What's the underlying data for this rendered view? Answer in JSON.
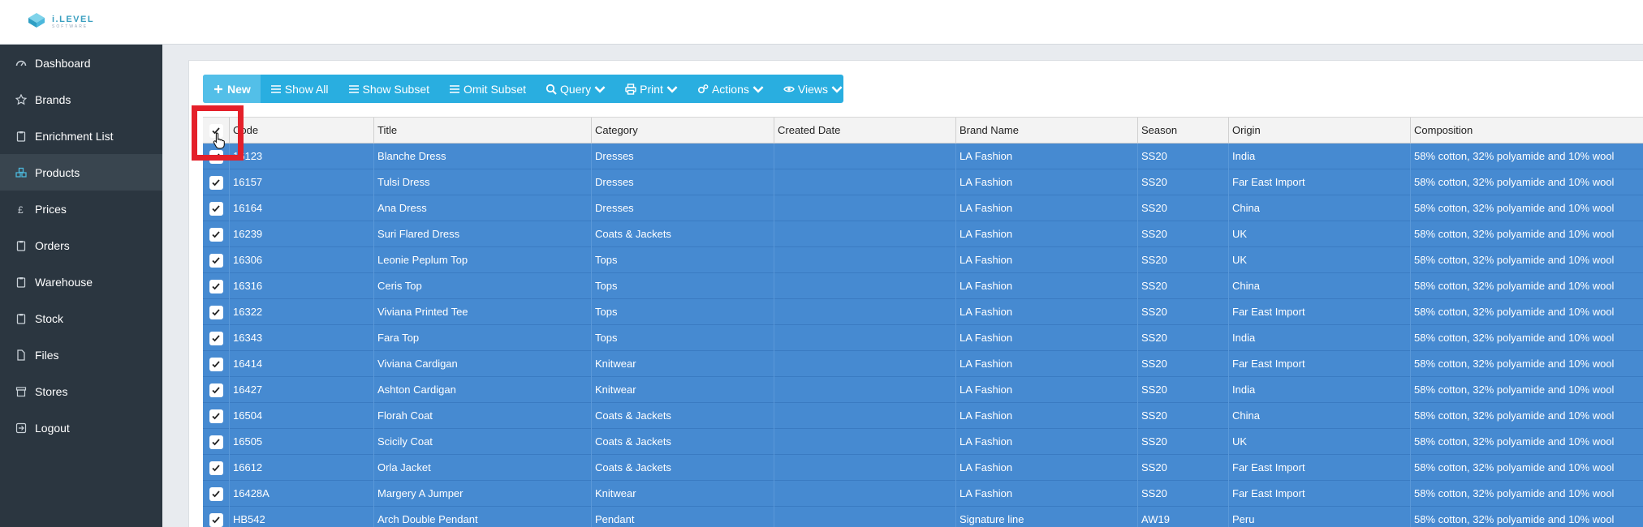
{
  "brand": {
    "name": "i.LEVEL",
    "tagline": "SOFTWARE"
  },
  "sidebar": {
    "items": [
      {
        "label": "Dashboard",
        "icon": "dashboard-icon"
      },
      {
        "label": "Brands",
        "icon": "star-icon"
      },
      {
        "label": "Enrichment List",
        "icon": "clipboard-icon"
      },
      {
        "label": "Products",
        "icon": "cubes-icon",
        "active": true
      },
      {
        "label": "Prices",
        "icon": "pound-icon"
      },
      {
        "label": "Orders",
        "icon": "clipboard-icon"
      },
      {
        "label": "Warehouse",
        "icon": "clipboard-icon"
      },
      {
        "label": "Stock",
        "icon": "clipboard-icon"
      },
      {
        "label": "Files",
        "icon": "file-icon"
      },
      {
        "label": "Stores",
        "icon": "store-icon"
      },
      {
        "label": "Logout",
        "icon": "logout-icon"
      }
    ]
  },
  "toolbar": {
    "new_label": "New",
    "show_all_label": "Show All",
    "show_subset_label": "Show Subset",
    "omit_subset_label": "Omit Subset",
    "query_label": "Query",
    "print_label": "Print",
    "actions_label": "Actions",
    "views_label": "Views"
  },
  "table": {
    "columns": [
      "Code",
      "Title",
      "Category",
      "Created Date",
      "Brand Name",
      "Season",
      "Origin",
      "Composition"
    ],
    "rows": [
      [
        "16123",
        "Blanche Dress",
        "Dresses",
        "",
        "LA Fashion",
        "SS20",
        "India",
        "58% cotton, 32% polyamide and 10% wool"
      ],
      [
        "16157",
        "Tulsi Dress",
        "Dresses",
        "",
        "LA Fashion",
        "SS20",
        "Far East Import",
        "58% cotton, 32% polyamide and 10% wool"
      ],
      [
        "16164",
        "Ana Dress",
        "Dresses",
        "",
        "LA Fashion",
        "SS20",
        "China",
        "58% cotton, 32% polyamide and 10% wool"
      ],
      [
        "16239",
        "Suri Flared Dress",
        "Coats & Jackets",
        "",
        "LA Fashion",
        "SS20",
        "UK",
        "58% cotton, 32% polyamide and 10% wool"
      ],
      [
        "16306",
        "Leonie Peplum Top",
        "Tops",
        "",
        "LA Fashion",
        "SS20",
        "UK",
        "58% cotton, 32% polyamide and 10% wool"
      ],
      [
        "16316",
        "Ceris Top",
        "Tops",
        "",
        "LA Fashion",
        "SS20",
        "China",
        "58% cotton, 32% polyamide and 10% wool"
      ],
      [
        "16322",
        "Viviana Printed Tee",
        "Tops",
        "",
        "LA Fashion",
        "SS20",
        "Far East Import",
        "58% cotton, 32% polyamide and 10% wool"
      ],
      [
        "16343",
        "Fara Top",
        "Tops",
        "",
        "LA Fashion",
        "SS20",
        "India",
        "58% cotton, 32% polyamide and 10% wool"
      ],
      [
        "16414",
        "Viviana Cardigan",
        "Knitwear",
        "",
        "LA Fashion",
        "SS20",
        "Far East Import",
        "58% cotton, 32% polyamide and 10% wool"
      ],
      [
        "16427",
        "Ashton Cardigan",
        "Knitwear",
        "",
        "LA Fashion",
        "SS20",
        "India",
        "58% cotton, 32% polyamide and 10% wool"
      ],
      [
        "16504",
        "Florah Coat",
        "Coats & Jackets",
        "",
        "LA Fashion",
        "SS20",
        "China",
        "58% cotton, 32% polyamide and 10% wool"
      ],
      [
        "16505",
        "Scicily Coat",
        "Coats & Jackets",
        "",
        "LA Fashion",
        "SS20",
        "UK",
        "58% cotton, 32% polyamide and 10% wool"
      ],
      [
        "16612",
        "Orla Jacket",
        "Coats & Jackets",
        "",
        "LA Fashion",
        "SS20",
        "Far East Import",
        "58% cotton, 32% polyamide and 10% wool"
      ],
      [
        "16428A",
        "Margery A Jumper",
        "Knitwear",
        "",
        "LA Fashion",
        "SS20",
        "Far East Import",
        "58% cotton, 32% polyamide and 10% wool"
      ],
      [
        "HB542",
        "Arch Double Pendant",
        "Pendant",
        "",
        "Signature line",
        "AW19",
        "Peru",
        "58% cotton, 32% polyamide and 10% wool"
      ]
    ]
  },
  "colors": {
    "selected_row": "#468ad1",
    "toolbar": "#29aee0",
    "sidebar": "#2b3640",
    "highlight": "#e4202a"
  }
}
